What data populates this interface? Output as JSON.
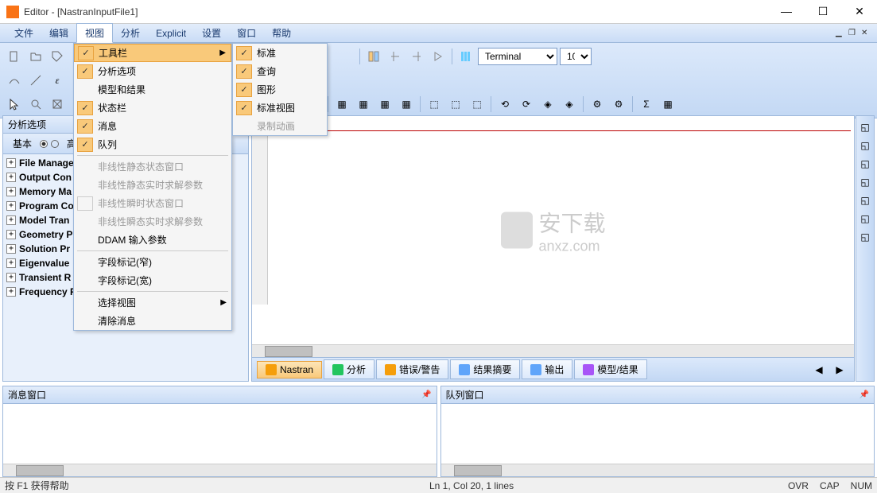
{
  "titlebar": {
    "title": "Editor - [NastranInputFile1]"
  },
  "menubar": {
    "items": [
      "文件",
      "编辑",
      "视图",
      "分析",
      "Explicit",
      "设置",
      "窗口",
      "帮助"
    ]
  },
  "view_menu": {
    "items": [
      {
        "label": "工具栏",
        "checked": true,
        "submenu": true,
        "highlighted": true
      },
      {
        "label": "分析选项",
        "checked": true
      },
      {
        "label": "模型和结果",
        "checked": false
      },
      {
        "label": "状态栏",
        "checked": true
      },
      {
        "label": "消息",
        "checked": true
      },
      {
        "label": "队列",
        "checked": true
      },
      {
        "sep": true
      },
      {
        "label": "非线性静态状态窗口",
        "disabled": true
      },
      {
        "label": "非线性静态实时求解参数",
        "disabled": true
      },
      {
        "label": "非线性瞬时状态窗口",
        "disabled": true,
        "checked": false,
        "showbox": true
      },
      {
        "label": "非线性瞬态实时求解参数",
        "disabled": true
      },
      {
        "label": "DDAM 输入参数"
      },
      {
        "sep": true
      },
      {
        "label": "字段标记(窄)"
      },
      {
        "label": "字段标记(宽)"
      },
      {
        "sep": true
      },
      {
        "label": "选择视图",
        "submenu": true
      },
      {
        "label": "清除消息"
      }
    ]
  },
  "toolbar_submenu": {
    "items": [
      {
        "label": "标准",
        "checked": true
      },
      {
        "label": "查询",
        "checked": true
      },
      {
        "label": "图形",
        "checked": true
      },
      {
        "label": "标准视图",
        "checked": true
      },
      {
        "label": "录制动画",
        "disabled": true
      }
    ]
  },
  "toolbar": {
    "terminal_label": "Terminal",
    "number": "10"
  },
  "left_panel": {
    "header": "分析选项",
    "tabs": {
      "basic": "基本",
      "adv": "高级"
    },
    "tree": [
      "File Manage",
      "Output Con",
      "Memory Ma",
      "Program Co",
      "Model Tran",
      "Geometry P",
      "Solution Pr",
      "Eigenvalue",
      "Transient R",
      "Frequency R"
    ]
  },
  "bottom_tabs": {
    "items": [
      {
        "label": "Nastran",
        "active": true,
        "color": "#f59e0b"
      },
      {
        "label": "分析",
        "color": "#22c55e"
      },
      {
        "label": "错误/警告",
        "color": "#f59e0b"
      },
      {
        "label": "结果摘要",
        "color": "#60a5fa"
      },
      {
        "label": "输出",
        "color": "#60a5fa"
      },
      {
        "label": "模型/结果",
        "color": "#a855f7"
      }
    ]
  },
  "bottom_panels": {
    "msg": "消息窗口",
    "queue": "队列窗口"
  },
  "statusbar": {
    "help": "按 F1 获得帮助",
    "pos": "Ln 1, Col 20, 1 lines",
    "ovr": "OVR",
    "cap": "CAP",
    "num": "NUM"
  },
  "watermark": {
    "text": "安下载",
    "url": "anxz.com"
  }
}
